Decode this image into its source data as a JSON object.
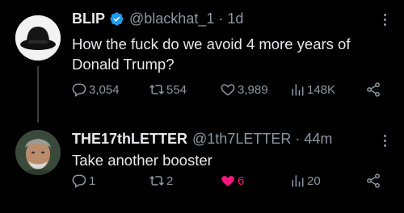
{
  "tweets": [
    {
      "name": "BLIP",
      "verified": true,
      "handle": "@blackhat_1",
      "separator": "·",
      "time": "1d",
      "text": "How the fuck do we avoid 4 more years of Donald Trump?",
      "replies": "3,054",
      "retweets": "554",
      "likes": "3,989",
      "views": "148K"
    },
    {
      "name": "THE17thLETTER",
      "verified": false,
      "handle": "@1th7LETTER",
      "separator": "·",
      "time": "44m",
      "text": "Take another booster",
      "replies": "1",
      "retweets": "2",
      "likes": "6",
      "liked": true,
      "views": "20"
    }
  ],
  "colors": {
    "background": "#000000",
    "text": "#e7e9ea",
    "muted": "#8b98a5",
    "verified": "#1d9bf0",
    "like": "#f91880"
  }
}
